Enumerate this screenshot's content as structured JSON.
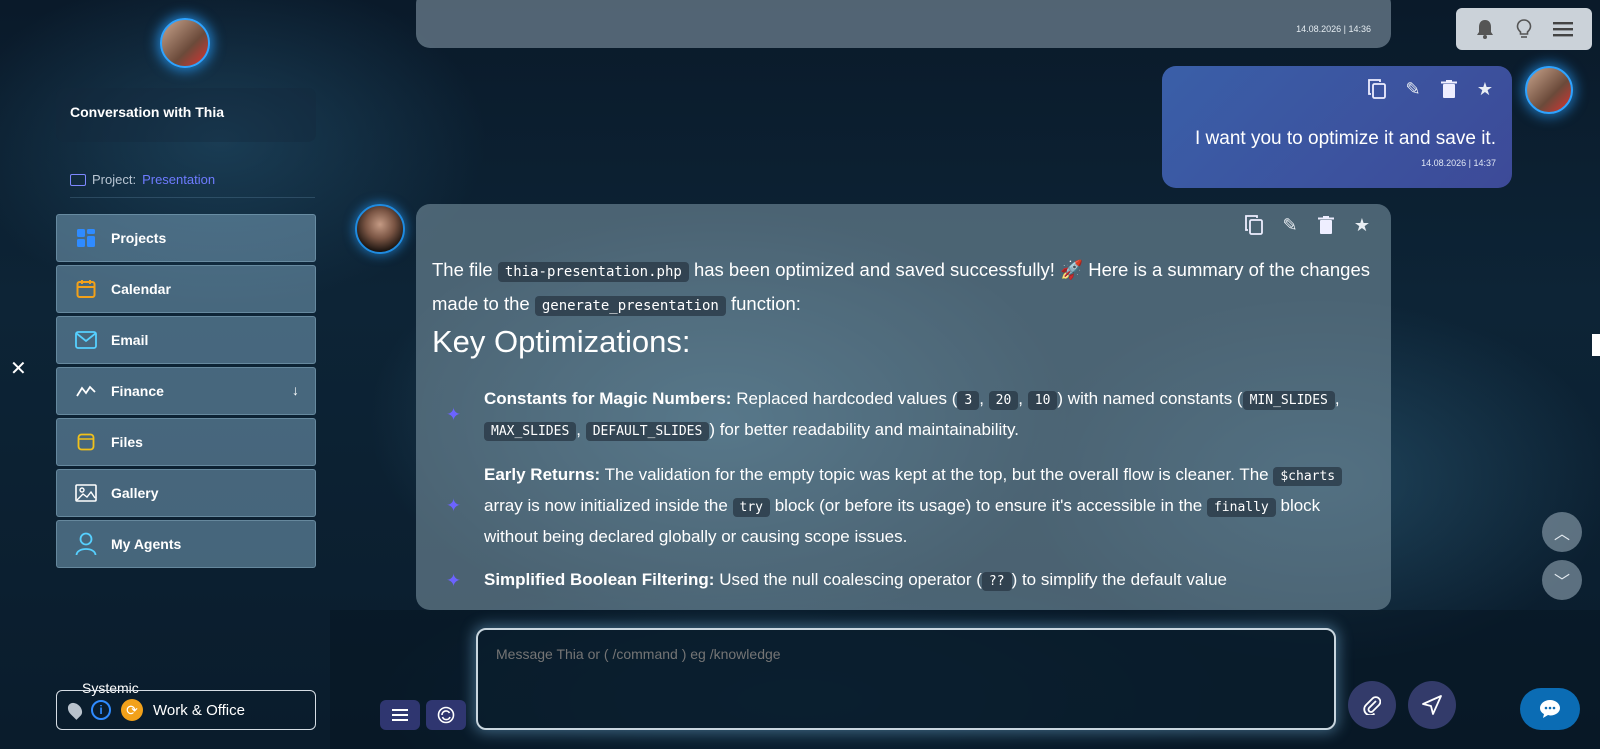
{
  "sidebar": {
    "conversation_title": "Conversation with Thia",
    "project_label": "Project:",
    "project_value": "Presentation",
    "items": [
      {
        "label": "Projects",
        "icon": "grid-icon"
      },
      {
        "label": "Calendar",
        "icon": "calendar-icon"
      },
      {
        "label": "Email",
        "icon": "mail-icon"
      },
      {
        "label": "Finance",
        "icon": "chart-icon"
      },
      {
        "label": "Files",
        "icon": "file-icon"
      },
      {
        "label": "Gallery",
        "icon": "image-icon"
      },
      {
        "label": "My Agents",
        "icon": "user-icon"
      }
    ],
    "systemic_label": "Systemic",
    "context_value": "Work & Office"
  },
  "messages": {
    "top_timestamp": "14.08.2026 | 14:36",
    "user": {
      "text": "I want you to optimize it and save it.",
      "timestamp": "14.08.2026 | 14:37"
    },
    "bot": {
      "intro_1": "The file ",
      "intro_code_1": "thia-presentation.php",
      "intro_2": " has been optimized and saved successfully! 🚀 Here is a summary of the changes made to the ",
      "intro_code_2": "generate_presentation",
      "intro_3": " function:",
      "heading": "Key Optimizations:",
      "b1_title": "Constants for Magic Numbers:",
      "b1_t1": " Replaced hardcoded values (",
      "b1_c1": "3",
      "b1_c2": "20",
      "b1_c3": "10",
      "b1_t2": ") with named constants (",
      "b1_c4": "MIN_SLIDES",
      "b1_c5": "MAX_SLIDES",
      "b1_c6": "DEFAULT_SLIDES",
      "b1_t3": ") for better readability and maintainability.",
      "b2_title": "Early Returns:",
      "b2_t1": " The validation for the empty topic was kept at the top, but the overall flow is cleaner. The ",
      "b2_c1": "$charts",
      "b2_t2": " array is now initialized inside the ",
      "b2_c2": "try",
      "b2_t3": " block (or before its usage) to ensure it's accessible in the ",
      "b2_c3": "finally",
      "b2_t4": " block without being declared globally or causing scope issues.",
      "b3_title": "Simplified Boolean Filtering:",
      "b3_t1": " Used the null coalescing operator (",
      "b3_c1": "??",
      "b3_t2": ") to simplify the default value"
    }
  },
  "composer": {
    "placeholder": "Message Thia or ( /command ) eg /knowledge"
  },
  "colors": {
    "accent": "#6e7bff",
    "user_bubble": "#3a5fa8",
    "fab": "#0b6cb4"
  }
}
